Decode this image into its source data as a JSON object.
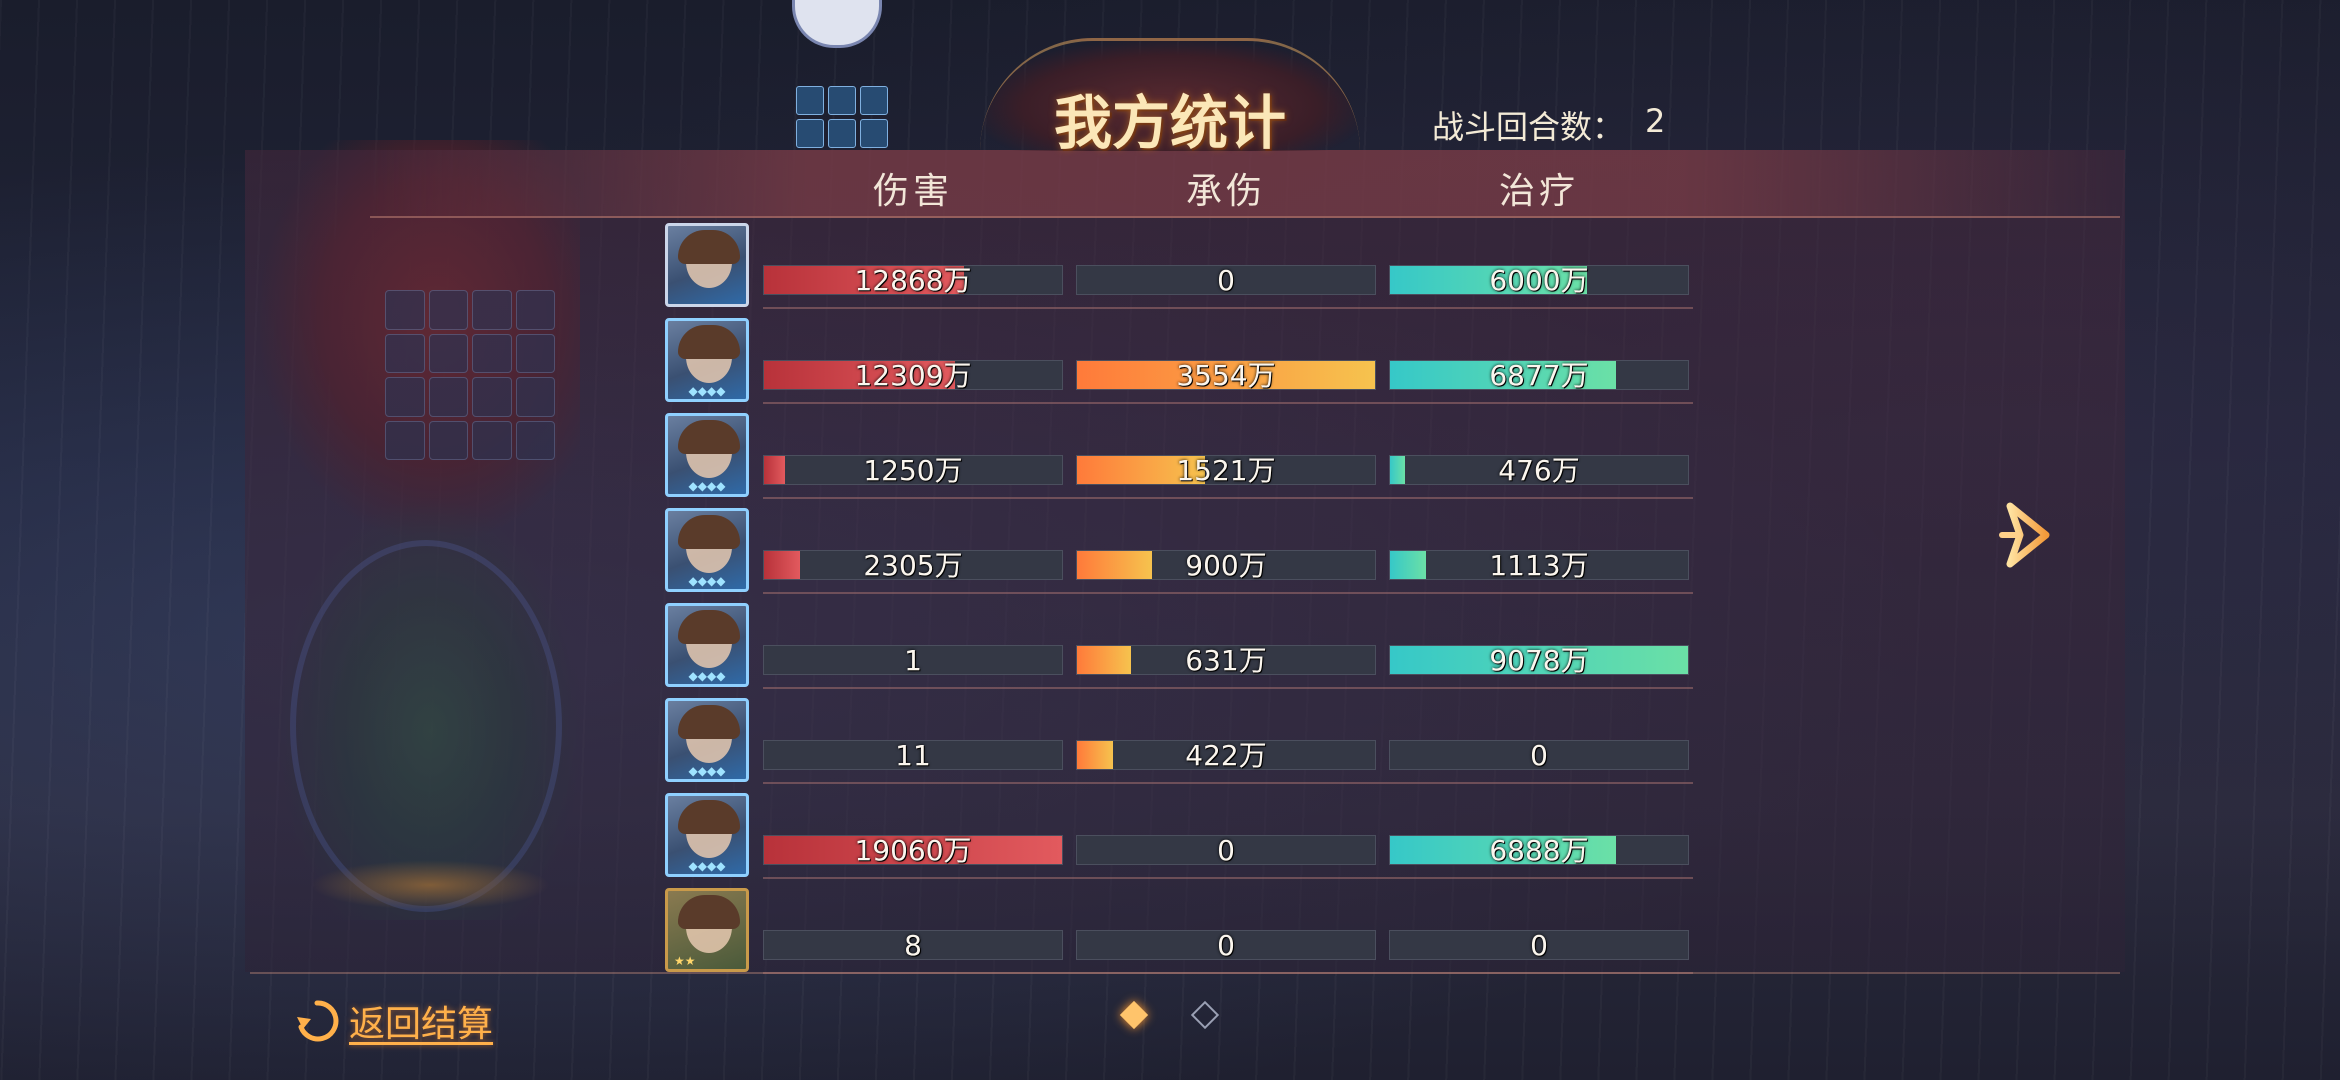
{
  "header": {
    "title": "我方统计",
    "round_label": "战斗回合数：",
    "round_value": "2"
  },
  "columns": {
    "damage": "伤害",
    "taken": "承伤",
    "heal": "治疗"
  },
  "rows": [
    {
      "damage": "12868万",
      "damage_pct": 0.67,
      "taken": "0",
      "taken_pct": 0,
      "heal": "6000万",
      "heal_pct": 0.66,
      "avatar_style": "plain"
    },
    {
      "damage": "12309万",
      "damage_pct": 0.64,
      "taken": "3554万",
      "taken_pct": 1.0,
      "heal": "6877万",
      "heal_pct": 0.76,
      "avatar_style": "blue"
    },
    {
      "damage": "1250万",
      "damage_pct": 0.07,
      "taken": "1521万",
      "taken_pct": 0.43,
      "heal": "476万",
      "heal_pct": 0.05,
      "avatar_style": "blue"
    },
    {
      "damage": "2305万",
      "damage_pct": 0.12,
      "taken": "900万",
      "taken_pct": 0.25,
      "heal": "1113万",
      "heal_pct": 0.12,
      "avatar_style": "blue"
    },
    {
      "damage": "1",
      "damage_pct": 0,
      "taken": "631万",
      "taken_pct": 0.18,
      "heal": "9078万",
      "heal_pct": 1.0,
      "avatar_style": "blue"
    },
    {
      "damage": "11",
      "damage_pct": 0,
      "taken": "422万",
      "taken_pct": 0.12,
      "heal": "0",
      "heal_pct": 0,
      "avatar_style": "blue"
    },
    {
      "damage": "19060万",
      "damage_pct": 1.0,
      "taken": "0",
      "taken_pct": 0,
      "heal": "6888万",
      "heal_pct": 0.76,
      "avatar_style": "blue"
    },
    {
      "damage": "8",
      "damage_pct": 0,
      "taken": "0",
      "taken_pct": 0,
      "heal": "0",
      "heal_pct": 0,
      "avatar_style": "gold"
    }
  ],
  "footer": {
    "back_label": "返回结算"
  },
  "pagination": {
    "current": 1,
    "total": 2
  },
  "colors": {
    "damage": "#d04148",
    "taken": "#ff9a40",
    "heal": "#45d0c0",
    "accent": "#ffb04a"
  }
}
